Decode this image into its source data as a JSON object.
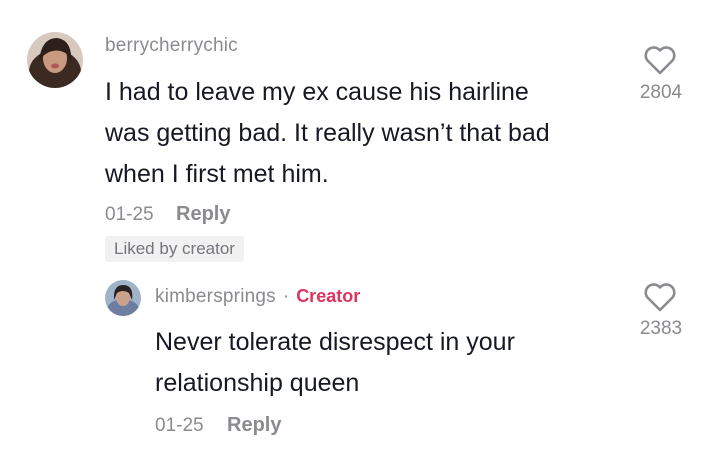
{
  "comment": {
    "username": "berrycherrychic",
    "text_lines": [
      "I had to leave my ex cause his hairline",
      "was getting bad. It really wasn’t that bad",
      "when I first met him."
    ],
    "date": "01-25",
    "reply_label": "Reply",
    "badge": "Liked by creator",
    "like_count": "2804",
    "heart_icon": "heart-outline-icon"
  },
  "reply": {
    "username": "kimbersprings",
    "separator": "·",
    "creator_label": "Creator",
    "text_lines": [
      "Never tolerate disrespect in your",
      "relationship queen"
    ],
    "date": "01-25",
    "reply_label": "Reply",
    "like_count": "2383",
    "heart_icon": "heart-outline-icon"
  },
  "colors": {
    "creator_accent": "#e0325e",
    "secondary_text": "#8a8b91",
    "primary_text": "#161823"
  }
}
